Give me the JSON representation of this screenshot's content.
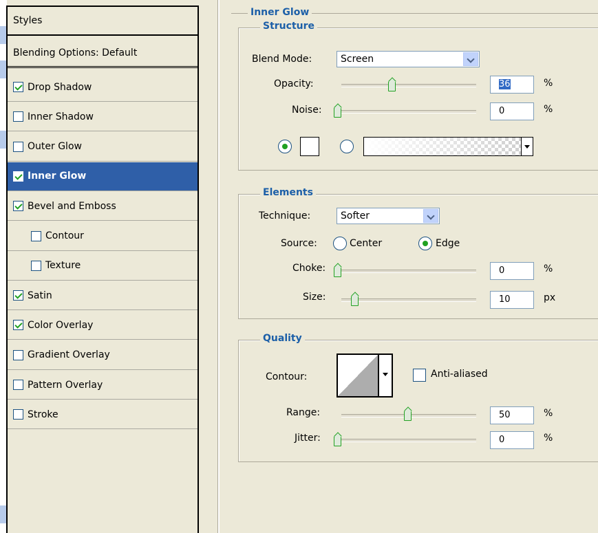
{
  "styles_panel": {
    "header": "Styles",
    "blending": "Blending Options: Default",
    "items": [
      {
        "label": "Drop Shadow",
        "checked": true,
        "selected": false,
        "indent": false
      },
      {
        "label": "Inner Shadow",
        "checked": false,
        "selected": false,
        "indent": false
      },
      {
        "label": "Outer Glow",
        "checked": false,
        "selected": false,
        "indent": false
      },
      {
        "label": "Inner Glow",
        "checked": true,
        "selected": true,
        "indent": false
      },
      {
        "label": "Bevel and Emboss",
        "checked": true,
        "selected": false,
        "indent": false
      },
      {
        "label": "Contour",
        "checked": false,
        "selected": false,
        "indent": true
      },
      {
        "label": "Texture",
        "checked": false,
        "selected": false,
        "indent": true
      },
      {
        "label": "Satin",
        "checked": true,
        "selected": false,
        "indent": false
      },
      {
        "label": "Color Overlay",
        "checked": true,
        "selected": false,
        "indent": false
      },
      {
        "label": "Gradient Overlay",
        "checked": false,
        "selected": false,
        "indent": false
      },
      {
        "label": "Pattern Overlay",
        "checked": false,
        "selected": false,
        "indent": false
      },
      {
        "label": "Stroke",
        "checked": false,
        "selected": false,
        "indent": false
      }
    ]
  },
  "inner_glow": {
    "title": "Inner Glow",
    "structure": {
      "title": "Structure",
      "blend_mode_label": "Blend Mode:",
      "blend_mode_value": "Screen",
      "opacity_label": "Opacity:",
      "opacity_value": "36",
      "opacity_unit": "%",
      "noise_label": "Noise:",
      "noise_value": "0",
      "noise_unit": "%",
      "color_mode": "solid"
    },
    "elements": {
      "title": "Elements",
      "technique_label": "Technique:",
      "technique_value": "Softer",
      "source_label": "Source:",
      "source_center": "Center",
      "source_edge": "Edge",
      "source_selected": "Edge",
      "choke_label": "Choke:",
      "choke_value": "0",
      "choke_unit": "%",
      "size_label": "Size:",
      "size_value": "10",
      "size_unit": "px"
    },
    "quality": {
      "title": "Quality",
      "contour_label": "Contour:",
      "anti_aliased_label": "Anti-aliased",
      "anti_aliased_checked": false,
      "range_label": "Range:",
      "range_value": "50",
      "range_unit": "%",
      "jitter_label": "Jitter:",
      "jitter_value": "0",
      "jitter_unit": "%"
    }
  },
  "colors": {
    "selected_row": "#2f5fa8",
    "legend_text": "#1c5fa8",
    "check_green": "#21a121",
    "panel_bg": "#ece9d8"
  }
}
